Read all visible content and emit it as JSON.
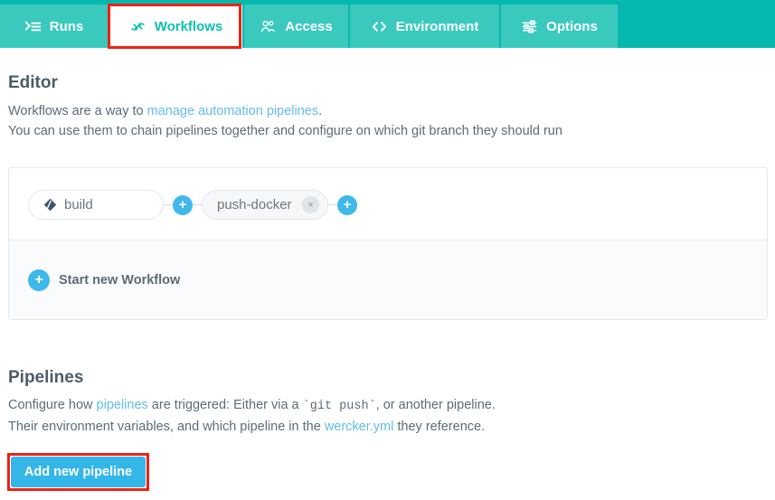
{
  "tabs": [
    {
      "id": "runs",
      "label": "Runs",
      "icon": "terminal-list-icon",
      "active": false
    },
    {
      "id": "workflows",
      "label": "Workflows",
      "icon": "workflow-link-icon",
      "active": true
    },
    {
      "id": "access",
      "label": "Access",
      "icon": "users-access-icon",
      "active": false
    },
    {
      "id": "environment",
      "label": "Environment",
      "icon": "code-brackets-icon",
      "active": false
    },
    {
      "id": "options",
      "label": "Options",
      "icon": "sliders-icon",
      "active": false
    }
  ],
  "editor": {
    "title": "Editor",
    "line1_pre": "Workflows are a way to ",
    "line1_link": "manage automation pipelines",
    "line1_post": ".",
    "line2": "You can use them to chain pipelines together and configure on which git branch they should run"
  },
  "workflow": {
    "nodes": [
      {
        "label": "build",
        "icon": "git-branch-diamond-icon",
        "removable": false
      },
      {
        "label": "push-docker",
        "icon": "",
        "removable": true,
        "remove_label": "×"
      }
    ],
    "add_button_label": "+",
    "start_new": {
      "icon": "plus-circle-icon",
      "label": "Start new Workflow"
    }
  },
  "pipelines": {
    "title": "Pipelines",
    "line1_pre": "Configure how ",
    "line1_link": "pipelines",
    "line1_mid": " are triggered: Either via a ",
    "line1_code": "`git push`",
    "line1_post": ", or another pipeline.",
    "line2_pre": "Their environment variables, and which pipeline in the ",
    "line2_link": "wercker.yml",
    "line2_post": " they reference.",
    "add_button_label": "Add new pipeline"
  },
  "highlights": [
    {
      "target": "workflows-tab",
      "color": "#ee2211"
    },
    {
      "target": "add-new-pipeline",
      "color": "#ee2211"
    }
  ],
  "colors": {
    "header_bar": "#05b8ae",
    "tab_inactive": "#3ac9bd",
    "tab_active_text": "#0bbfb4",
    "link": "#62bdec",
    "accent_blue": "#35b6e9",
    "highlight_red": "#ee2211"
  }
}
